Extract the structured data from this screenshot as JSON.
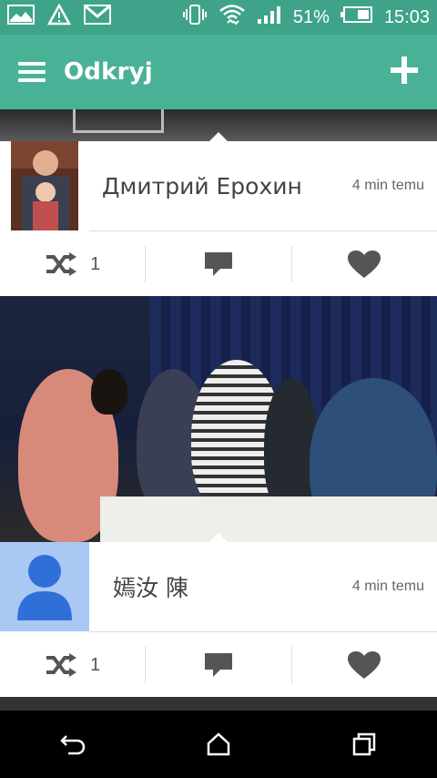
{
  "status": {
    "battery_text": "51%",
    "time": "15:03",
    "icons": [
      "picture-icon",
      "alert-icon",
      "gmail-icon",
      "vibrate-icon",
      "wifi-icon",
      "signal-icon",
      "battery-icon"
    ]
  },
  "app_bar": {
    "title": "Odkryj",
    "menu_icon": "hamburger-icon",
    "add_icon": "plus-icon"
  },
  "posts": [
    {
      "user_name": "Дмитрий Ерохин",
      "time": "4 min temu",
      "reshare_count": "1"
    },
    {
      "user_name": "嫣汝 陳",
      "time": "4 min temu",
      "reshare_count": "1"
    }
  ],
  "colors": {
    "status_bar": "#3ea389",
    "app_bar": "#49b296",
    "icon_gray": "#555555"
  }
}
